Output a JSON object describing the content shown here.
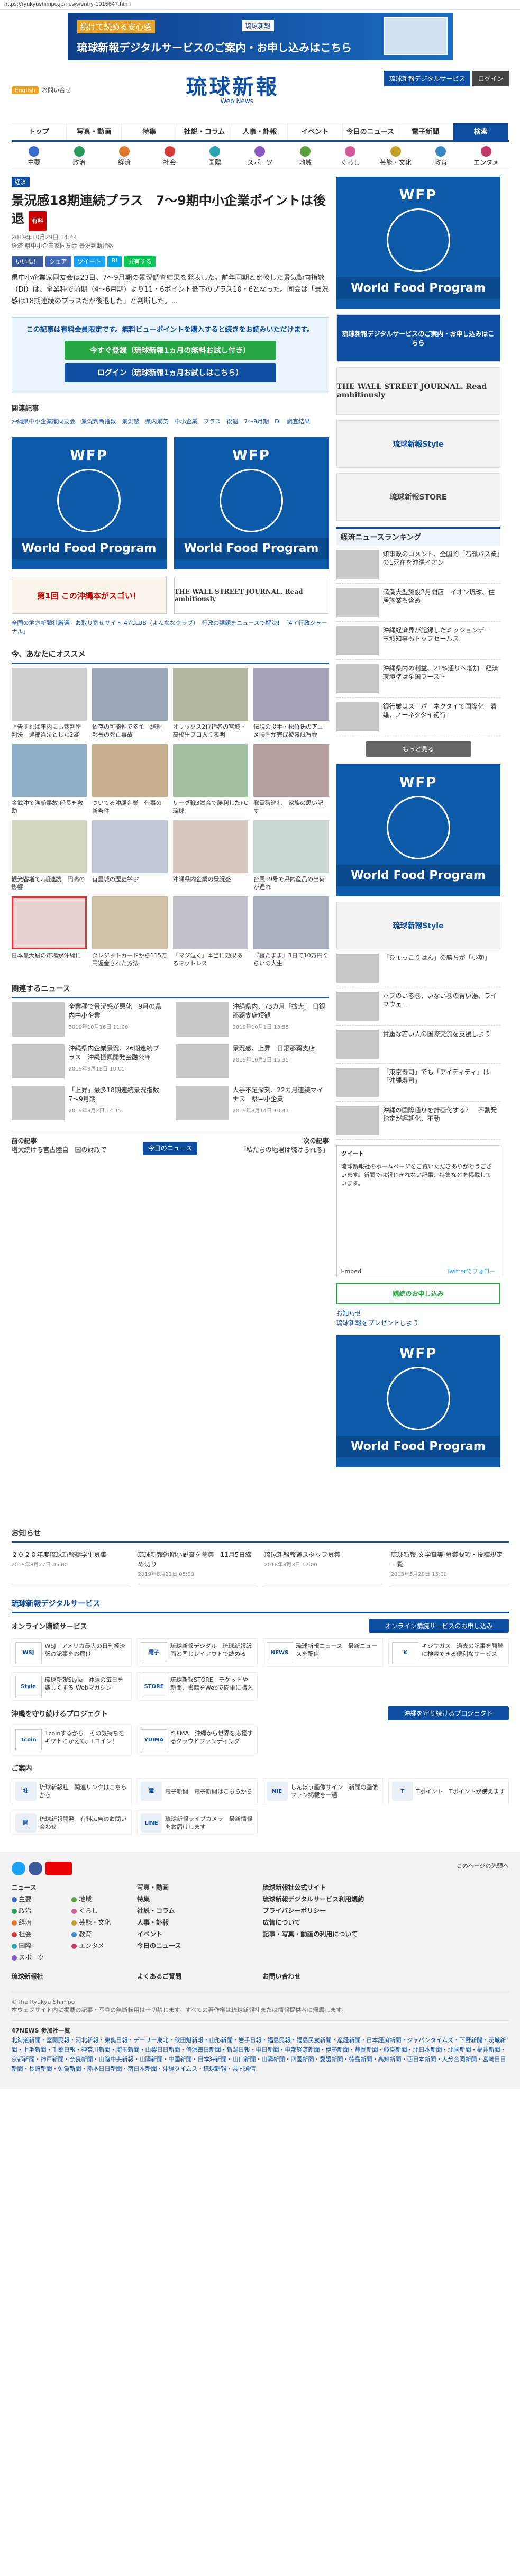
{
  "url": "https://ryukyushimpo.jp/news/entry-1015647.html",
  "top_banner": {
    "line1": "続けて読める安心感",
    "line2": "琉球新報デジタルサービスのご案内・お申し込みはこちら",
    "logo": "琉球新報"
  },
  "header": {
    "logo": "琉球新報",
    "logo_sub": "Web News",
    "lang_btn": "English",
    "lang_links": "お問い合せ",
    "buttons": [
      "琉球新報デジタルサービス",
      "ログイン"
    ]
  },
  "gnav": [
    "トップ",
    "写真・動画",
    "特集",
    "社説・コラム",
    "人事・訃報",
    "イベント",
    "今日のニュース",
    "電子新聞",
    "検索"
  ],
  "snav": [
    {
      "label": "主要",
      "color": "#3b6cc8"
    },
    {
      "label": "政治",
      "color": "#2a9d5a"
    },
    {
      "label": "経済",
      "color": "#e07a2a"
    },
    {
      "label": "社会",
      "color": "#d43b3b"
    },
    {
      "label": "国際",
      "color": "#2aa6b0"
    },
    {
      "label": "スポーツ",
      "color": "#8a5ac2"
    },
    {
      "label": "地域",
      "color": "#5aa03c"
    },
    {
      "label": "くらし",
      "color": "#d45a9a"
    },
    {
      "label": "芸能・文化",
      "color": "#c2a12a"
    },
    {
      "label": "教育",
      "color": "#3a8ac2"
    },
    {
      "label": "エンタメ",
      "color": "#c23a6a"
    }
  ],
  "article": {
    "category": "経済",
    "title": "景況感18期連続プラス　7～9期中小企業ポイントは後退",
    "badge": "有料",
    "date": "2019年10月29日 14:44",
    "meta": "経済 県中小企業家同友会 景況判断指数",
    "share": [
      "いいね！",
      "シェア",
      "ツイート",
      "B!",
      "共有する"
    ],
    "body": "県中小企業家同友会は23日、7～9月期の景況調査結果を発表した。前年同期と比較した景気動向指数（DI）は、全業種で前期（4～6月期）より11・6ポイント低下のプラス10・6となった。同会は「景況感は18期連続のプラスだが後退した」と判断した。..."
  },
  "paywall": {
    "msg": "この記事は有料会員限定です。無料ビューポイントを購入すると続きをお読みいただけます。",
    "register": "今すぐ登録（琉球新報1ヵ月の無料お試し付き）",
    "login": "ログイン（琉球新報1ヵ月お試しはこちら）"
  },
  "related": {
    "heading": "関連記事",
    "tags": "沖縄県中小企業家同友会　景況判断指数　景況感　県内景気　中小企業　プラス　後退　7～9月期　DI　調査結果"
  },
  "wfp": {
    "title": "WFP",
    "foot": "World Food Program"
  },
  "okinawa_banner": {
    "left": "第1回 この沖縄本がスゴい！",
    "right": "THE WALL STREET JOURNAL. Read ambitiously"
  },
  "promo_line": "全国の地方新聞社厳選　お取り寄せサイト 47CLUB（よんななクラブ）　行政の課題をニュースで解決！「4７行政ジャーナル」",
  "recommended": {
    "heading": "今、あなたにオススメ",
    "items": [
      "上告すれば年内にも裁判所判決　逮捕違法とした2審",
      "依存の可能性で多忙　経理部長の死亡事故",
      "オリックス2位指名の宮城・高校生プロ入り表明",
      "伝説の投手・松竹氏のアニメ映画が完成披露試写会",
      "金武沖で漁船事故 船長を救助",
      "ついてる沖縄企業　仕事の新条件",
      "リーグ戦3試合で勝利したFC琉球",
      "慰霊碑巡礼　家族の思い記す",
      "観光客増で2期連続　円高の影響",
      "首里城の歴史学ぶ",
      "沖縄県内企業の景況感",
      "台風19号で県内産品の出荷が遅れ",
      "日本最大級の市場が沖縄に",
      "クレジットカードから115万円返金された方法",
      "「マジ泣く」本当に効果あるマットレス",
      "『寝たまま』3日で10万円くらいの人生"
    ]
  },
  "news_list": {
    "heading": "関連するニュース",
    "items": [
      {
        "t": "全業種で景況感が悪化　9月の県内中小企業",
        "d": "2019年10月16日 11:00"
      },
      {
        "t": "沖縄県内、73カ月「拡大」 日銀那覇支店短観",
        "d": "2019年10月1日 13:55"
      },
      {
        "t": "沖縄県内企業景況、26期連続プラス　沖縄振興開発金融公庫",
        "d": "2019年9月18日 10:05"
      },
      {
        "t": "景況感、上昇　日銀那覇支店",
        "d": "2019年10月2日 15:35"
      },
      {
        "t": "「上昇」最多18期連続景況指数　7～9月期",
        "d": "2019年8月2日 14:15"
      },
      {
        "t": "人手不足深刻、22カ月連続マイナス　県中小企業",
        "d": "2019年8月14日 10:41"
      }
    ]
  },
  "prevnext": {
    "prev_label": "前の記事",
    "prev_title": "増大続ける宮古陸自　国の財政で",
    "center": "今日のニュース",
    "next_label": "次の記事",
    "next_title": "「私たちの地場は続けられる」"
  },
  "side": {
    "digital_banner": "琉球新報デジタルサービスのご案内・お申し込みはこちら",
    "wsj": "THE WALL STREET JOURNAL. Read ambitiously",
    "style": "琉球新報Style",
    "store": "琉球新報STORE",
    "rank_heading": "経済ニュースランキング",
    "rank": [
      "知事政のコメント、全国的「石嶺バス業」の1死在を沖縄イオン",
      "満潮大型施設2月開店　イオン琉球、住居施業も含め",
      "沖縄経済界が記録したミッションデー　玉城知事もトップセールス",
      "沖縄県内の利益、21%通りへ増加　経済環境準は全国ワースト",
      "銀行業はスーパーネクタイで国際化　清雄、ノーネクタイ初行"
    ],
    "more": "もっと見る",
    "tw_title": "ツイート",
    "tw_text": "琉球新報社のホームページをご覧いただきありがとうございます。新聞では報じきれない記事、特集などを掲載しています。",
    "tw_follow": "Twitterでフォロー",
    "tw_embed": "Embed",
    "subscribe": "購読のお申し込み",
    "present": "お知らせ",
    "present2": "琉球新報をプレゼントしよう",
    "rank2": [
      "「ひょっこりはん」の勝ちが「少額」",
      "ハブのいる巻、いない巻の青い湯、ライフウェー",
      "貴重な若い人の国際交流を支援しよう",
      "「東京寿司」でも「アイディティ」は「沖縄寿司」",
      "沖縄の国際通りを計画化する？　不動発指定が遅延化、不動"
    ]
  },
  "notices": {
    "heading": "お知らせ",
    "items": [
      {
        "t": "２０２０年度琉球新報奨学生募集",
        "d": "2019年8月27日 05:00"
      },
      {
        "t": "琉球新報短期小説賞を募集　11月5日締め切り",
        "d": "2019年8月21日 05:00"
      },
      {
        "t": "琉球新報報道スタッフ募集",
        "d": "2018年8月3日 17:00"
      },
      {
        "t": "琉球新報 文学賞等 募集要項・投稿規定一覧",
        "d": "2018年5月29日 15:00"
      }
    ]
  },
  "digital": {
    "heading": "琉球新報デジタルサービス",
    "online_label": "オンライン購読サービス",
    "online_btn": "オンライン購読サービスのお申し込み",
    "services": [
      {
        "icon": "WSJ",
        "t": "WSJ　アメリカ最大の日刊経済紙の記事をお届け"
      },
      {
        "icon": "電子",
        "t": "琉球新報デジタル　琉球新報紙面と同じレイアウトで読める"
      },
      {
        "icon": "NEWS",
        "t": "琉球新報ニュース　最新ニュースを配信"
      },
      {
        "icon": "K",
        "t": "キジサガス　過去の記事を簡単に検索できる便利なサービス"
      },
      {
        "icon": "Style",
        "t": "琉球新報Style　沖縄の毎日を楽しくする Webマガジン"
      },
      {
        "icon": "STORE",
        "t": "琉球新報STORE　チケットや新聞、書籍をWebで簡単に購入"
      }
    ],
    "project_label": "沖縄を守り続けるプロジェクト",
    "project_btn": "沖縄を守り続けるプロジェクト",
    "projects": [
      {
        "icon": "1coin",
        "t": "1coinするから　その気持ちをギフトにかえて、1コイン！"
      },
      {
        "icon": "YUIMA",
        "t": "YUIMA　沖縄から世界を応援するクラウドファンディング"
      }
    ],
    "guide_label": "ご案内",
    "guides": [
      {
        "icon": "社",
        "t": "琉球新報社　関連リンクはこちらから"
      },
      {
        "icon": "電",
        "t": "電子新聞　電子新聞はこちらから"
      },
      {
        "icon": "NIE",
        "t": "しんぽう画像サイン　新聞の画像ファン掲載を一通"
      },
      {
        "icon": "T",
        "t": "Tポイント　Tポイントが使えます"
      },
      {
        "icon": "開",
        "t": "琉球新報開発　有料広告のお問い合わせ"
      },
      {
        "icon": "LINE",
        "t": "琉球新報ライブカメラ　最新情報をお届けします"
      }
    ]
  },
  "footer": {
    "top_link": "このページの先頭へ",
    "col1_title": "ニュース",
    "col1": [
      "主要",
      "政治",
      "経済",
      "社会",
      "国際",
      "スポーツ",
      "地域",
      "くらし",
      "芸能・文化",
      "教育",
      "エンタメ"
    ],
    "col2": [
      "写真・動画",
      "特集",
      "社説・コラム",
      "人事・訃報",
      "イベント",
      "今日のニュース"
    ],
    "col3": [
      "琉球新報社",
      "よくあるご質問"
    ],
    "col4": [
      "琉球新報社公式サイト",
      "琉球新報デジタルサービス利用規約",
      "プライバシーポリシー",
      "広告について",
      "記事・写真・動画の利用について",
      "お問い合わせ"
    ],
    "copyright": "©The Ryukyu Shimpo",
    "note": "本ウェブサイト内に掲載の記事・写真の無断転用は一切禁じます。すべての著作権は琉球新報社または情報提供者に帰属します。",
    "news47": "47NEWS 参加社一覧",
    "news47_list": "北海道新聞・室蘭民報・河北新報・東奥日報・デーリー東北・秋田魁新報・山形新聞・岩手日報・福島民報・福島民友新聞・産経新聞・日本経済新聞・ジャパンタイムズ・下野新聞・茨城新聞・上毛新聞・千葉日報・神奈川新聞・埼玉新聞・山梨日日新聞・信濃毎日新聞・新潟日報・中日新聞・中部経済新聞・伊勢新聞・静岡新聞・岐阜新聞・北日本新聞・北國新聞・福井新聞・京都新聞・神戸新聞・奈良新聞・山陰中央新報・山陽新聞・中国新聞・日本海新聞・山口新聞・山陽新聞・四国新聞・愛媛新聞・徳島新聞・高知新聞・西日本新聞・大分合同新聞・宮崎日日新聞・長崎新聞・佐賀新聞・熊本日日新聞・南日本新聞・沖縄タイムス・琉球新報・共同通信"
  }
}
